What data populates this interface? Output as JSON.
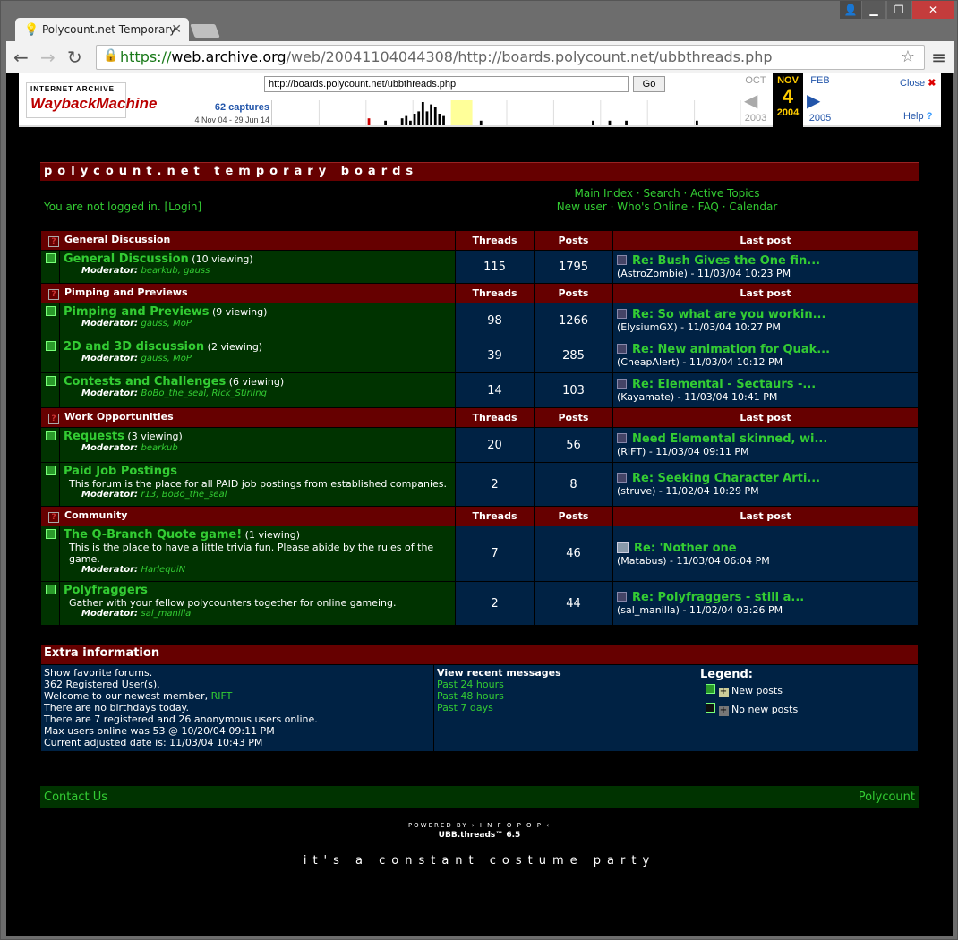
{
  "browser": {
    "tab_title": "Polycount.net Temporary",
    "url_scheme": "https://",
    "url_domain": "web.archive.org",
    "url_path": "/web/20041104044308/http://boards.polycount.net/ubbthreads.php"
  },
  "wayback": {
    "logo_top": "INTERNET ARCHIVE",
    "logo_main": "WaybackMachine",
    "url_value": "http://boards.polycount.net/ubbthreads.php",
    "go_label": "Go",
    "captures": "62 captures",
    "range": "4 Nov 04 - 29 Jun 14",
    "prev_month": "OCT",
    "prev_year": "2003",
    "cur_month": "NOV",
    "cur_day": "4",
    "cur_year": "2004",
    "next_month": "FEB",
    "next_year": "2005",
    "close": "Close",
    "help": "Help",
    "spark_values": [
      0,
      0,
      0,
      0,
      0,
      0,
      0,
      0,
      0,
      0,
      0,
      0,
      0,
      0,
      0,
      0,
      0,
      0,
      0,
      0,
      0,
      0,
      0,
      0.3,
      0,
      0,
      0,
      0.2,
      0,
      0,
      0,
      0.3,
      0.4,
      0.2,
      0.5,
      0.6,
      1,
      0.6,
      0.9,
      0.8,
      0.5,
      0.4,
      0,
      0,
      0,
      0,
      0,
      0,
      0,
      0,
      0.2,
      0,
      0,
      0,
      0,
      0,
      0,
      0,
      0,
      0,
      0,
      0,
      0,
      0,
      0,
      0,
      0,
      0,
      0,
      0,
      0,
      0,
      0,
      0,
      0,
      0,
      0,
      0.2,
      0,
      0,
      0,
      0.2,
      0,
      0,
      0,
      0.2,
      0,
      0,
      0,
      0,
      0,
      0,
      0,
      0,
      0,
      0,
      0,
      0,
      0,
      0,
      0,
      0,
      0.2,
      0,
      0,
      0,
      0,
      0,
      0,
      0,
      0,
      0,
      0
    ]
  },
  "site": {
    "title": "polycount.net temporary boards",
    "not_logged": "You are not logged in. ",
    "login": "[Login]",
    "links1": "Main Index · Search · Active Topics",
    "links2": "New user · Who's Online · FAQ · Calendar"
  },
  "columns": {
    "threads": "Threads",
    "posts": "Posts",
    "last": "Last post"
  },
  "categories": [
    {
      "name": "General Discussion"
    },
    {
      "name": "Pimping and Previews"
    },
    {
      "name": "Work Opportunities"
    },
    {
      "name": "Community"
    }
  ],
  "forums": [
    {
      "name": "General Discussion",
      "viewing": " (10 viewing)",
      "mods": "bearkub, gauss",
      "threads": "115",
      "posts": "1795",
      "last_title": "Re: Bush Gives the One fin...",
      "last_by": "(AstroZombie) - 11/03/04 10:23 PM"
    },
    {
      "name": "Pimping and Previews",
      "viewing": " (9 viewing)",
      "mods": "gauss, MoP",
      "threads": "98",
      "posts": "1266",
      "last_title": "Re: So what are you workin...",
      "last_by": "(ElysiumGX) - 11/03/04 10:27 PM"
    },
    {
      "name": "2D and 3D discussion",
      "viewing": " (2 viewing)",
      "mods": "gauss, MoP",
      "threads": "39",
      "posts": "285",
      "last_title": "Re: New animation for Quak...",
      "last_by": "(CheapAlert) - 11/03/04 10:12 PM"
    },
    {
      "name": "Contests and Challenges",
      "viewing": " (6 viewing)",
      "mods": "BoBo_the_seal, Rick_Stirling",
      "threads": "14",
      "posts": "103",
      "last_title": "Re: Elemental - Sectaurs -...",
      "last_by": "(Kayamate) - 11/03/04 10:41 PM"
    },
    {
      "name": "Requests",
      "viewing": " (3 viewing)",
      "mods": "bearkub",
      "threads": "20",
      "posts": "56",
      "last_title": "Need Elemental skinned, wi...",
      "last_by": "(RIFT) - 11/03/04 09:11 PM"
    },
    {
      "name": "Paid Job Postings",
      "viewing": "",
      "desc": "This forum is the place for all PAID job postings from established companies.",
      "mods": "r13, BoBo_the_seal",
      "threads": "2",
      "posts": "8",
      "last_title": "Re: Seeking Character Arti...",
      "last_by": "(struve) - 11/02/04 10:29 PM"
    },
    {
      "name": "The Q-Branch Quote game!",
      "viewing": " (1 viewing)",
      "desc": "This is the place to have a little trivia fun. Please abide by the rules of the game.",
      "mods": "HarlequiN",
      "threads": "7",
      "posts": "46",
      "last_title": "Re: 'Nother one",
      "last_by": "(Matabus) - 11/03/04 06:04 PM"
    },
    {
      "name": "Polyfraggers",
      "viewing": "",
      "desc": "Gather with your fellow polycounters together for online gameing.",
      "mods": "sal_manilla",
      "threads": "2",
      "posts": "44",
      "last_title": "Re: Polyfraggers - still a...",
      "last_by": "(sal_manilla) - 11/02/04 03:26 PM"
    }
  ],
  "moderator_label": "Moderator:",
  "extra": {
    "title": "Extra information",
    "l1": "Show favorite forums.",
    "l2": "362 Registered User(s).",
    "l3": "Welcome to our newest member, ",
    "newest": "RIFT",
    "l4": "There are no birthdays today.",
    "l5": "There are 7 registered and 26 anonymous users online.",
    "l6": "Max users online was 53 @ 10/20/04 09:11 PM",
    "l7": "Current adjusted date is: 11/03/04 10:43 PM",
    "recent_title": "View recent messages",
    "r1": "Past 24 hours",
    "r2": "Past 48 hours",
    "r3": "Past 7 days",
    "legend_title": "Legend:",
    "legend_new": "New posts",
    "legend_none": "No new posts"
  },
  "footer": {
    "contact": "Contact Us",
    "brand": "Polycount",
    "powered": "POWERED BY  › I N F O P O P ‹",
    "ubb": "UBB.threads™ 6.5",
    "tagline": "it's a constant costume party"
  }
}
